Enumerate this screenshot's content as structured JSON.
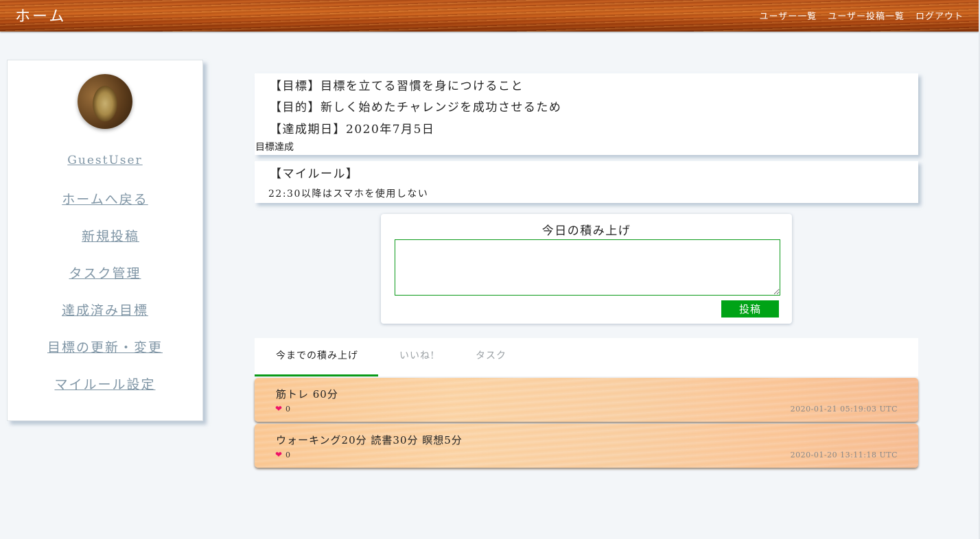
{
  "header": {
    "title": "ホーム",
    "nav": [
      "ユーザー一覧",
      "ユーザー投稿一覧",
      "ログアウト"
    ]
  },
  "sidebar": {
    "username": "GuestUser",
    "links": [
      "ホームへ戻る",
      "新規投稿",
      "タスク管理",
      "達成済み目標",
      "目標の更新・変更",
      "マイルール設定"
    ]
  },
  "goal": {
    "target": "【目標】目標を立てる習慣を身につけること",
    "purpose": "【目的】新しく始めたチャレンジを成功させるため",
    "deadline": "【達成期日】2020年7月5日",
    "status": "目標達成"
  },
  "rules": {
    "title": "【マイルール】",
    "text": "22:30以降はスマホを使用しない"
  },
  "post_form": {
    "title": "今日の積み上げ",
    "textarea_value": "",
    "button_label": "投稿"
  },
  "tabs": [
    "今までの積み上げ",
    "いいね!",
    "タスク"
  ],
  "posts": [
    {
      "text": "筋トレ 60分",
      "likes": "0",
      "timestamp": "2020-01-21 05:19:03 UTC"
    },
    {
      "text": "ウォーキング20分 読書30分 瞑想5分",
      "likes": "0",
      "timestamp": "2020-01-20 13:11:18 UTC"
    }
  ],
  "colors": {
    "accent": "#0a9a18",
    "button": "#00a316",
    "heart": "#ee1166",
    "link": "#7f95a5"
  },
  "icons": {
    "like": "heart-icon"
  }
}
